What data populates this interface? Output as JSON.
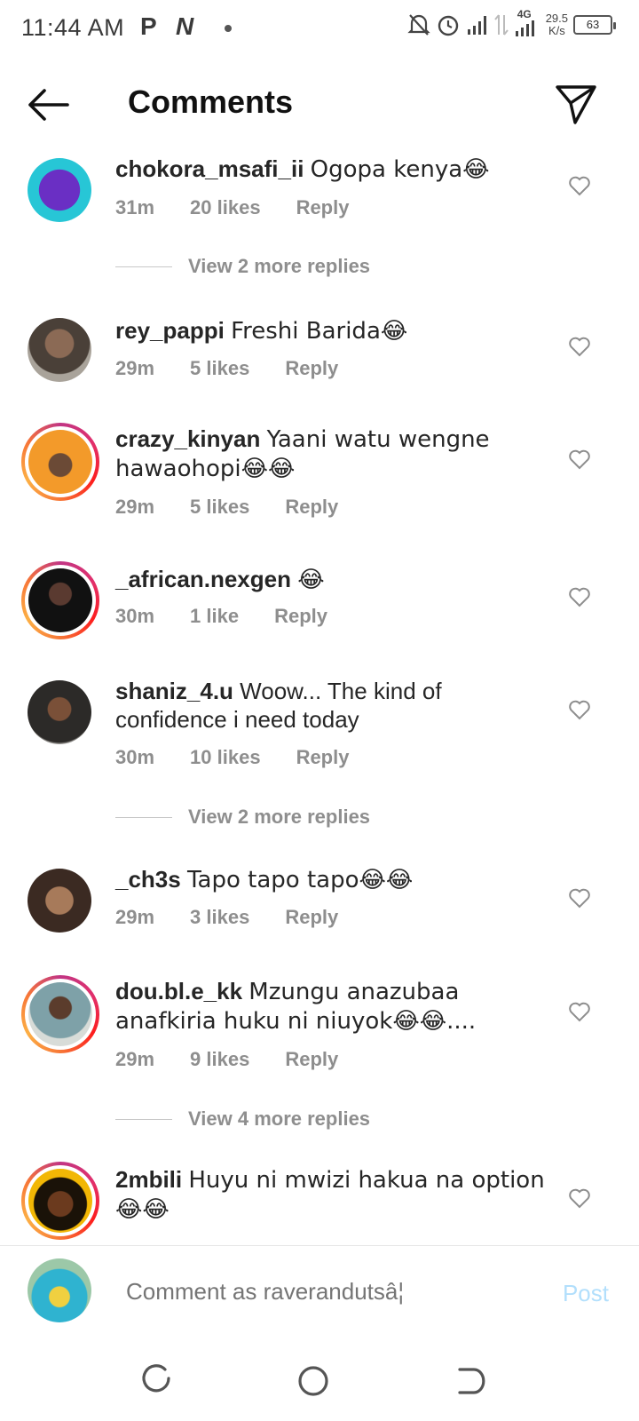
{
  "status_bar": {
    "time": "11:44 AM",
    "app_icons": [
      "P",
      "N"
    ],
    "network_label": "4G",
    "speed_value": "29.5",
    "speed_unit": "K/s",
    "battery": "63"
  },
  "header": {
    "title": "Comments"
  },
  "comments": [
    {
      "username": "chokora_msafi_ii",
      "text": "Ogopa kenya😂",
      "time": "31m",
      "likes": "20 likes",
      "reply": "Reply",
      "more_replies": "View 2 more replies"
    },
    {
      "username": "rey_pappi",
      "text": "Freshi Barida😂",
      "time": "29m",
      "likes": "5 likes",
      "reply": "Reply"
    },
    {
      "username": "crazy_kinyan",
      "text": "Yaani watu wengne hawaohopi😂😂",
      "time": "29m",
      "likes": "5 likes",
      "reply": "Reply"
    },
    {
      "username": "_african.nexgen",
      "text": "😂",
      "time": "30m",
      "likes": "1 like",
      "reply": "Reply"
    },
    {
      "username": "shaniz_4.u",
      "text": "Woow... The kind of confidence i need today",
      "time": "30m",
      "likes": "10 likes",
      "reply": "Reply",
      "more_replies": "View 2 more replies"
    },
    {
      "username": "_ch3s",
      "text": "Tapo tapo tapo😂😂",
      "time": "29m",
      "likes": "3 likes",
      "reply": "Reply"
    },
    {
      "username": "dou.bl.e_kk",
      "text": "Mzungu anazubaa anafkiria huku ni niuyok😂😂....",
      "time": "29m",
      "likes": "9 likes",
      "reply": "Reply",
      "more_replies": "View 4 more replies"
    },
    {
      "username": "2mbili",
      "text": "Huyu ni mwizi hakua na option 😂😂"
    }
  ],
  "composer": {
    "placeholder": "Comment as raverandutsâ¦",
    "post_label": "Post"
  },
  "colors": {
    "accent_post": "#b2dffc",
    "meta_gray": "#8e8e8e",
    "text": "#262626"
  }
}
